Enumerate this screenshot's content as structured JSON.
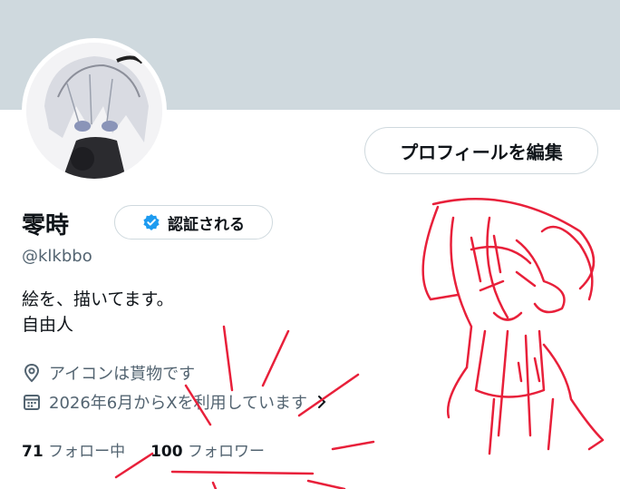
{
  "profile": {
    "display_name": "零時",
    "verify_label": "認証される",
    "handle": "@klkbbo",
    "bio_lines": [
      "絵を、描いてます。",
      "自由人"
    ],
    "location": "アイコンは貰物です",
    "joined": "2026年6月からXを利用しています",
    "edit_button": "プロフィールを編集"
  },
  "stats": {
    "following_count": "71",
    "following_label": "フォロー中",
    "followers_count": "100",
    "followers_label": "フォロワー"
  },
  "icons": {
    "verified": "verified-check-icon",
    "location": "location-pin-icon",
    "calendar": "calendar-icon",
    "chevron": "chevron-right-icon"
  },
  "colors": {
    "banner": "#cfd9de",
    "verified_blue": "#1d9bf0",
    "scribble_red": "#e8203a"
  }
}
